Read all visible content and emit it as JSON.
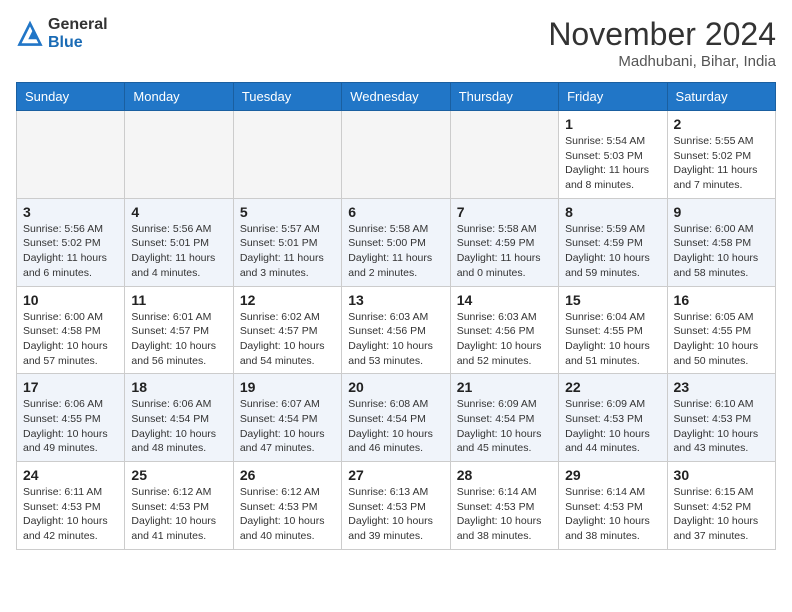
{
  "header": {
    "logo_general": "General",
    "logo_blue": "Blue",
    "month_title": "November 2024",
    "location": "Madhubani, Bihar, India"
  },
  "weekdays": [
    "Sunday",
    "Monday",
    "Tuesday",
    "Wednesday",
    "Thursday",
    "Friday",
    "Saturday"
  ],
  "weeks": [
    [
      {
        "day": "",
        "info": ""
      },
      {
        "day": "",
        "info": ""
      },
      {
        "day": "",
        "info": ""
      },
      {
        "day": "",
        "info": ""
      },
      {
        "day": "",
        "info": ""
      },
      {
        "day": "1",
        "info": "Sunrise: 5:54 AM\nSunset: 5:03 PM\nDaylight: 11 hours and 8 minutes."
      },
      {
        "day": "2",
        "info": "Sunrise: 5:55 AM\nSunset: 5:02 PM\nDaylight: 11 hours and 7 minutes."
      }
    ],
    [
      {
        "day": "3",
        "info": "Sunrise: 5:56 AM\nSunset: 5:02 PM\nDaylight: 11 hours and 6 minutes."
      },
      {
        "day": "4",
        "info": "Sunrise: 5:56 AM\nSunset: 5:01 PM\nDaylight: 11 hours and 4 minutes."
      },
      {
        "day": "5",
        "info": "Sunrise: 5:57 AM\nSunset: 5:01 PM\nDaylight: 11 hours and 3 minutes."
      },
      {
        "day": "6",
        "info": "Sunrise: 5:58 AM\nSunset: 5:00 PM\nDaylight: 11 hours and 2 minutes."
      },
      {
        "day": "7",
        "info": "Sunrise: 5:58 AM\nSunset: 4:59 PM\nDaylight: 11 hours and 0 minutes."
      },
      {
        "day": "8",
        "info": "Sunrise: 5:59 AM\nSunset: 4:59 PM\nDaylight: 10 hours and 59 minutes."
      },
      {
        "day": "9",
        "info": "Sunrise: 6:00 AM\nSunset: 4:58 PM\nDaylight: 10 hours and 58 minutes."
      }
    ],
    [
      {
        "day": "10",
        "info": "Sunrise: 6:00 AM\nSunset: 4:58 PM\nDaylight: 10 hours and 57 minutes."
      },
      {
        "day": "11",
        "info": "Sunrise: 6:01 AM\nSunset: 4:57 PM\nDaylight: 10 hours and 56 minutes."
      },
      {
        "day": "12",
        "info": "Sunrise: 6:02 AM\nSunset: 4:57 PM\nDaylight: 10 hours and 54 minutes."
      },
      {
        "day": "13",
        "info": "Sunrise: 6:03 AM\nSunset: 4:56 PM\nDaylight: 10 hours and 53 minutes."
      },
      {
        "day": "14",
        "info": "Sunrise: 6:03 AM\nSunset: 4:56 PM\nDaylight: 10 hours and 52 minutes."
      },
      {
        "day": "15",
        "info": "Sunrise: 6:04 AM\nSunset: 4:55 PM\nDaylight: 10 hours and 51 minutes."
      },
      {
        "day": "16",
        "info": "Sunrise: 6:05 AM\nSunset: 4:55 PM\nDaylight: 10 hours and 50 minutes."
      }
    ],
    [
      {
        "day": "17",
        "info": "Sunrise: 6:06 AM\nSunset: 4:55 PM\nDaylight: 10 hours and 49 minutes."
      },
      {
        "day": "18",
        "info": "Sunrise: 6:06 AM\nSunset: 4:54 PM\nDaylight: 10 hours and 48 minutes."
      },
      {
        "day": "19",
        "info": "Sunrise: 6:07 AM\nSunset: 4:54 PM\nDaylight: 10 hours and 47 minutes."
      },
      {
        "day": "20",
        "info": "Sunrise: 6:08 AM\nSunset: 4:54 PM\nDaylight: 10 hours and 46 minutes."
      },
      {
        "day": "21",
        "info": "Sunrise: 6:09 AM\nSunset: 4:54 PM\nDaylight: 10 hours and 45 minutes."
      },
      {
        "day": "22",
        "info": "Sunrise: 6:09 AM\nSunset: 4:53 PM\nDaylight: 10 hours and 44 minutes."
      },
      {
        "day": "23",
        "info": "Sunrise: 6:10 AM\nSunset: 4:53 PM\nDaylight: 10 hours and 43 minutes."
      }
    ],
    [
      {
        "day": "24",
        "info": "Sunrise: 6:11 AM\nSunset: 4:53 PM\nDaylight: 10 hours and 42 minutes."
      },
      {
        "day": "25",
        "info": "Sunrise: 6:12 AM\nSunset: 4:53 PM\nDaylight: 10 hours and 41 minutes."
      },
      {
        "day": "26",
        "info": "Sunrise: 6:12 AM\nSunset: 4:53 PM\nDaylight: 10 hours and 40 minutes."
      },
      {
        "day": "27",
        "info": "Sunrise: 6:13 AM\nSunset: 4:53 PM\nDaylight: 10 hours and 39 minutes."
      },
      {
        "day": "28",
        "info": "Sunrise: 6:14 AM\nSunset: 4:53 PM\nDaylight: 10 hours and 38 minutes."
      },
      {
        "day": "29",
        "info": "Sunrise: 6:14 AM\nSunset: 4:53 PM\nDaylight: 10 hours and 38 minutes."
      },
      {
        "day": "30",
        "info": "Sunrise: 6:15 AM\nSunset: 4:52 PM\nDaylight: 10 hours and 37 minutes."
      }
    ]
  ]
}
